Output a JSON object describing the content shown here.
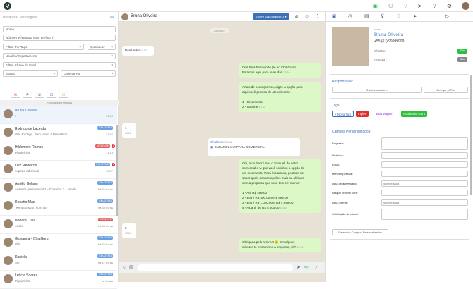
{
  "topbar": {
    "logo_letter": "Q"
  },
  "left": {
    "search_placeholder": "Pesquisar Mensagens",
    "fields": [
      {
        "label": "Nome",
        "type": "input"
      },
      {
        "label": "Número Whatsapp (sem prefixo 0)",
        "type": "input"
      },
      {
        "label": "Filtrar Por Tags",
        "type": "select"
      },
      {
        "label": "Usuário/Departamento",
        "type": "select"
      },
      {
        "label": "Filtrar Chave do Funil",
        "type": "select"
      }
    ],
    "quaisquer_label": "Quaisquer",
    "status_label": "Status",
    "order_label": "Ordenar Por",
    "filter_buttons": [
      "✉",
      "⚑",
      "☏",
      "☐",
      "☐"
    ],
    "section_label": "Resultados Filtrados",
    "contacts": [
      {
        "name": "Bruna Oliveira",
        "msg": "1",
        "time": "13:13",
        "tag": "",
        "tag_color": "",
        "badge": "",
        "active": true
      },
      {
        "name": "Rodrigo de Lacerda",
        "msg": "Olá, Rodrigo. Bem vindo a PressFirm",
        "time": "13:47",
        "tag": "EM ATEND",
        "tag_color": "#6aa0e0",
        "badge": "",
        "active": false
      },
      {
        "name": "Hildemere Ramos",
        "msg": "Piguirrinha",
        "time": "13:15",
        "tag": "URGENTE",
        "tag_color": "#e25c5c",
        "badge": "1",
        "active": false
      },
      {
        "name": "Luiz Medeiros",
        "msg": "suporte adicional",
        "time": "12:07",
        "tag": "EM ATEND",
        "tag_color": "#6aa0e0",
        "badge": "1",
        "active": false
      },
      {
        "name": "Amélio Holanu",
        "msg": "Assento preferencial 1 - Corredor 2 - Janela",
        "time": "há 35 horas",
        "tag": "EM ATEND",
        "tag_color": "#6aa0e0",
        "badge": "",
        "active": false
      },
      {
        "name": "Renatto Max",
        "msg": "\"Renatto Max\" fiom dia",
        "time": "há 38 horas",
        "tag": "EM ATEND",
        "tag_color": "#6aa0e0",
        "badge": "",
        "active": false
      },
      {
        "name": "Isadora Luna",
        "msg": "Áudio",
        "time": "há 34 horas",
        "tag": "URGENTE",
        "tag_color": "#e25c5c",
        "badge": "",
        "active": false
      },
      {
        "name": "Giovanna - ChatGuru",
        "msg": "Olá",
        "time": "há 35 horas",
        "tag": "EM ATEND",
        "tag_color": "#6aa0e0",
        "badge": "",
        "active": false
      },
      {
        "name": "Daniela",
        "msg": "Sim",
        "time": "há 41 horas",
        "tag": "EM ATEND",
        "tag_color": "#6aa0e0",
        "badge": "",
        "active": false
      },
      {
        "name": "Letícia Soares",
        "msg": "Piguirrinha",
        "time": "há 4 dias",
        "tag": "EM ATEND",
        "tag_color": "#6aa0e0",
        "badge": "",
        "active": false
      }
    ]
  },
  "chat": {
    "contact_name": "Bruna Oliveira",
    "attend_label": "EM ATENDIMENTO ▾",
    "date_chip": "25/03/22",
    "messages": [
      {
        "dir": "in",
        "text": "Boa tarde!",
        "time": "13:10"
      },
      {
        "dir": "out",
        "text": "Olá! Seja bem-vindo (a) ao ChatGuru!\nEstamos aqui para te ajudar!",
        "time": "13:10"
      },
      {
        "dir": "out",
        "text": "Antes de começarmos, digite a opção para\naqui você precisa de atendimento:\n\n1 - Orçamento\n2 - Suporte",
        "time": "13:10"
      },
      {
        "dir": "in",
        "text": "1",
        "time": "13:12"
      },
      {
        "dir": "out",
        "text": "Olá, tudo bem? Sou o Samuel, do setor\ncomercial e vi que você solicitou a opção de\num orçamento. Para iniciarmos, gostaria de\nsaber quais desses opções mais se alinham\ncom a proposta que você tem em mente:\n\n1 - Até R$ 499,00\n2 - Entre R$ 500,00 e R$ 999,00\n3 - Entre R$ 1.000,00 e R$ 4.999,00\n4 - A partir de R$ 5.000,00",
        "time": "13:12"
      },
      {
        "dir": "in",
        "text": "3",
        "time": "13:13"
      },
      {
        "dir": "out",
        "text": "Obrigado pelo retorno! 😊 Em alguns\nminutos te encaminho a proposta, ok?",
        "time": "13:13"
      }
    ],
    "chatbot": {
      "title": "Chatbot",
      "subtitle": "enviou:",
      "option": "ENCAMINHAR PARA COMERCIAL"
    }
  },
  "right": {
    "name_label": "nome",
    "name": "Bruna Oliveira",
    "phone": "+55 (61) 99999999",
    "chatbot_label": "Chatbot:",
    "chatbot_toggle": "Sim",
    "arquivar_label": "Arquivar:",
    "arquivar_toggle": "Não",
    "responsavel_label": "Responsável:",
    "selected_label": "3 selecionados ▾",
    "delegate_label": "Delegar p/ Fila",
    "tags_label": "Tags:",
    "new_tag_label": "+ Nova Tag",
    "tags": [
      {
        "label": "Inglês",
        "bg": "#e0322c",
        "color": "#ffffff"
      },
      {
        "label": "Boa viagem",
        "bg": "#ffffff",
        "color": "#7b2bd0"
      },
      {
        "label": "Academia Guru",
        "bg": "#2fbf3f",
        "color": "#ffffff"
      }
    ],
    "custom_fields_label": "Campos Personalizados:",
    "custom_fields": [
      {
        "label": "Empresa:",
        "value": ""
      },
      {
        "label": "Histórico:",
        "value": ""
      },
      {
        "label": "Email:",
        "value": ""
      },
      {
        "label": "telefone pessoal:",
        "value": ""
      },
      {
        "label": "Data de aniversário:",
        "value": "dd/mm/aaaa"
      },
      {
        "label": "nasque ondelin com:",
        "value": ""
      },
      {
        "label": "Data Cliente:",
        "value": "dd/mm/aaaa"
      },
      {
        "label": "Solicitação do cliente:",
        "value": ""
      }
    ],
    "save_fields_label": "Gerenciar Campos Personalizados"
  },
  "colors": {
    "accent": "#3d6fb6",
    "whatsapp": "#2dbf4e",
    "chat_bg": "#e8e2d6",
    "bubble_out": "#dcf8c6"
  }
}
